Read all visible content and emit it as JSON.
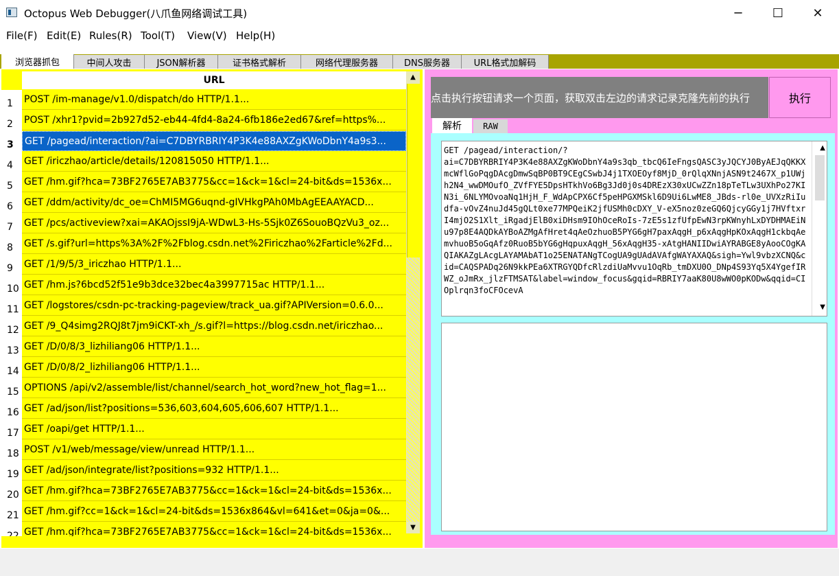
{
  "window": {
    "title": "Octopus Web Debugger(八爪鱼网络调试工具)",
    "minimize_glyph": "─",
    "maximize_glyph": "☐",
    "close_glyph": "✕",
    "app_icon": "app-window-icon"
  },
  "menu": [
    "File(F)",
    "Edit(E)",
    "Rules(R)",
    "Tool(T)",
    "View(V)",
    "Help(H)"
  ],
  "tabs": [
    "浏览器抓包",
    "中间人攻击",
    "JSON解析器",
    "证书格式解析",
    "网络代理服务器",
    "DNS服务器",
    "URL格式加解码"
  ],
  "active_tab": 0,
  "grid": {
    "header": "URL",
    "selected_row": 3,
    "rows": [
      {
        "num": "1",
        "url": "POST /im-manage/v1.0/dispatch/do HTTP/1.1..."
      },
      {
        "num": "2",
        "url": "POST /xhr1?pvid=2b927d52-eb44-4fd4-8a24-6fb186e2ed67&ref=https%..."
      },
      {
        "num": "3",
        "url": "GET /pagead/interaction/?ai=C7DBYRBRIY4P3K4e88AXZgKWoDbnY4a9s3..."
      },
      {
        "num": "4",
        "url": "GET /iriczhao/article/details/120815050 HTTP/1.1..."
      },
      {
        "num": "5",
        "url": "GET /hm.gif?hca=73BF2765E7AB3775&cc=1&ck=1&cl=24-bit&ds=1536x..."
      },
      {
        "num": "6",
        "url": "GET /ddm/activity/dc_oe=ChMI5MG6uqnd-gIVHkgPAh0MbAgEEAAYACD..."
      },
      {
        "num": "7",
        "url": "GET /pcs/activeview?xai=AKAOjssI9jA-WDwL3-Hs-5Sjk0Z6SouoBQzVu3_oz..."
      },
      {
        "num": "8",
        "url": "GET /s.gif?url=https%3A%2F%2Fblog.csdn.net%2Firiczhao%2Farticle%2Fd..."
      },
      {
        "num": "9",
        "url": "GET /1/9/5/3_iriczhao HTTP/1.1..."
      },
      {
        "num": "10",
        "url": "GET /hm.js?6bcd52f51e9b3dce32bec4a3997715ac HTTP/1.1..."
      },
      {
        "num": "11",
        "url": "GET /logstores/csdn-pc-tracking-pageview/track_ua.gif?APIVersion=0.6.0..."
      },
      {
        "num": "12",
        "url": "GET /9_Q4simg2RQJ8t7jm9iCKT-xh_/s.gif?l=https://blog.csdn.net/iriczhao..."
      },
      {
        "num": "13",
        "url": "GET /D/0/8/3_lizhiliang06 HTTP/1.1..."
      },
      {
        "num": "14",
        "url": "GET /D/0/8/2_lizhiliang06 HTTP/1.1..."
      },
      {
        "num": "15",
        "url": "OPTIONS /api/v2/assemble/list/channel/search_hot_word?new_hot_flag=1..."
      },
      {
        "num": "16",
        "url": "GET /ad/json/list?positions=536,603,604,605,606,607 HTTP/1.1..."
      },
      {
        "num": "17",
        "url": "GET /oapi/get HTTP/1.1..."
      },
      {
        "num": "18",
        "url": "POST /v1/web/message/view/unread HTTP/1.1..."
      },
      {
        "num": "19",
        "url": "GET /ad/json/integrate/list?positions=932 HTTP/1.1..."
      },
      {
        "num": "20",
        "url": "GET /hm.gif?hca=73BF2765E7AB3775&cc=1&ck=1&cl=24-bit&ds=1536x..."
      },
      {
        "num": "21",
        "url": "GET /hm.gif?cc=1&ck=1&cl=24-bit&ds=1536x864&vl=641&et=0&ja=0&..."
      },
      {
        "num": "22",
        "url": "GET /hm.gif?hca=73BF2765E7AB3775&cc=1&ck=1&cl=24-bit&ds=1536x..."
      }
    ]
  },
  "right": {
    "prompt": "点击执行按钮请求一个页面，获取双击左边的请求记录克隆先前的执行",
    "execute_label": "执行",
    "subtabs": [
      "解析",
      "RAW"
    ],
    "request_text": "GET /pagead/interaction/?\nai=C7DBYRBRIY4P3K4e88AXZgKWoDbnY4a9s3qb_tbcQ6IeFngsQASC3yJQCYJ0ByAEJqQKKXmcWflGoPqgDAcgDmwSqBP0BT9CEgCSwbJ4j1TXOEOyf8MjD_0rQlqXNnjASN9t2467X_p1UWjh2N4_wwDMOufO_ZVfFYE5DpsHTkhVo6Bg3Jd0j0s4DREzX30xUCwZZn18pTeTLw3UXhPo27KIN3i_6NLYMOvoaNq1HjH_F_WdApCPX6Cf5peHPGXMSkl6D9Ui6LwME8_JBds-rl0e_UVXzRiIudfa-vOvZ4nuJd45gQLt0xe77MPQeiK2jfUSMh0cDXY_V-eX5noz0zeGQ6QjcyGGy1j7HVftxrI4mjO2S1Xlt_iRgadjElB0xiDHsm9IOhOceRoIs-7zE5s1zfUfpEwN3rpKWnyhLxDYDHMAEiNu97p8E4AQDkAYBoAZMgAfHret4qAeOzhuoB5PYG6gH7paxAqgH_p6xAqgHpKOxAqgH1ckbqAemvhuoB5oGqAfz0RuoB5bYG6gHqpuxAqgH_56xAqgH35-xAtgHANIIDwiAYRABGE8yAooCOgKAQIAKAZgLAcgLAYAMAbAT1o25ENATANgTCogUA9gUAdAVAfgWAYAXAQ&sigh=Ywl9vbzXCNQ&cid=CAQSPADq26N9kkPEa6XTRGYQDfcRlzdiUaMvvu1OqRb_tmDXU0O_DNp4S93Yq5X4YgefIRWZ_oJmRx_jlzFTMSAT&label=window_focus&gqid=RBRIY7aaK80U8wWO0pKODw&qqid=CIOplrqn3foCFOcevA",
    "response_text": ""
  }
}
